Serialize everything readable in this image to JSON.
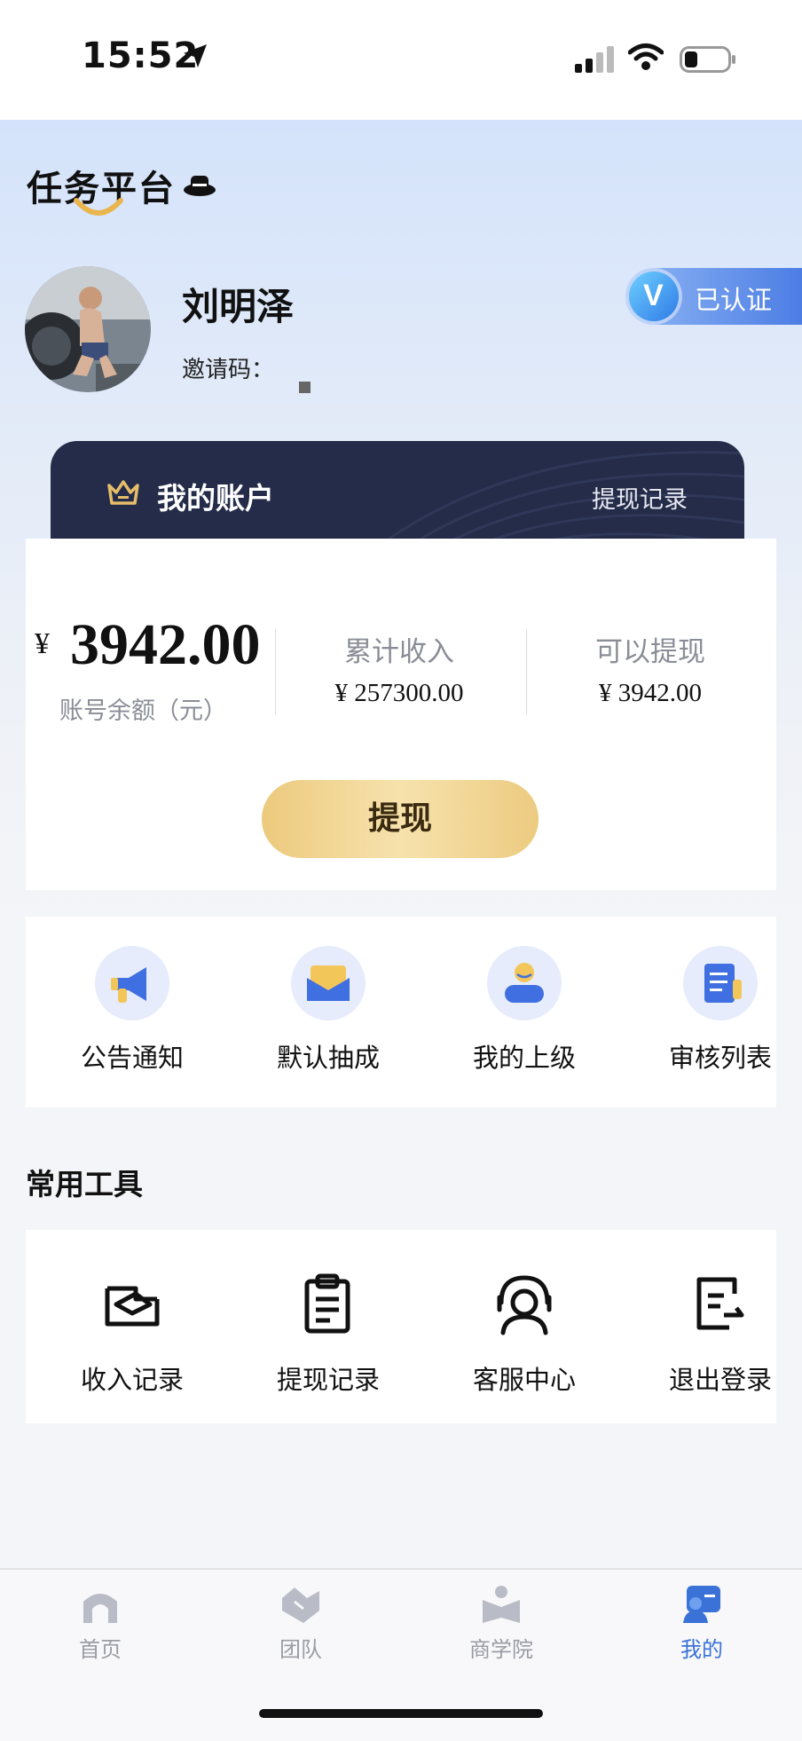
{
  "status_bar": {
    "time": "15:52"
  },
  "app": {
    "logo_text": "任务平台"
  },
  "profile": {
    "name": "刘明泽",
    "invite_label": "邀请码：",
    "verified_label": "已认证"
  },
  "account": {
    "title": "我的账户",
    "record_link": "提现记录",
    "currency": "¥",
    "balance": "3942.00",
    "balance_label": "账号余额（元）",
    "stats": [
      {
        "label": "累计收入",
        "value": "¥ 257300.00"
      },
      {
        "label": "可以提现",
        "value": "¥ 3942.00"
      }
    ],
    "withdraw_label": "提现"
  },
  "quick_actions": [
    {
      "label": "公告通知",
      "icon": "megaphone-icon"
    },
    {
      "label": "默认抽成",
      "icon": "envelope-icon"
    },
    {
      "label": "我的上级",
      "icon": "person-icon"
    },
    {
      "label": "审核列表",
      "icon": "list-document-icon"
    }
  ],
  "tools": {
    "title": "常用工具",
    "items": [
      {
        "label": "收入记录",
        "icon": "income-record-icon"
      },
      {
        "label": "提现记录",
        "icon": "clipboard-icon"
      },
      {
        "label": "客服中心",
        "icon": "headset-icon"
      },
      {
        "label": "退出登录",
        "icon": "logout-document-icon"
      }
    ]
  },
  "tabbar": [
    {
      "label": "首页",
      "icon": "home-icon",
      "active": false
    },
    {
      "label": "团队",
      "icon": "team-icon",
      "active": false
    },
    {
      "label": "商学院",
      "icon": "academy-icon",
      "active": false
    },
    {
      "label": "我的",
      "icon": "profile-icon",
      "active": true
    }
  ],
  "colors": {
    "accent": "#3a72d8",
    "card_dark": "#242c49",
    "gold": "#ecca7d"
  }
}
